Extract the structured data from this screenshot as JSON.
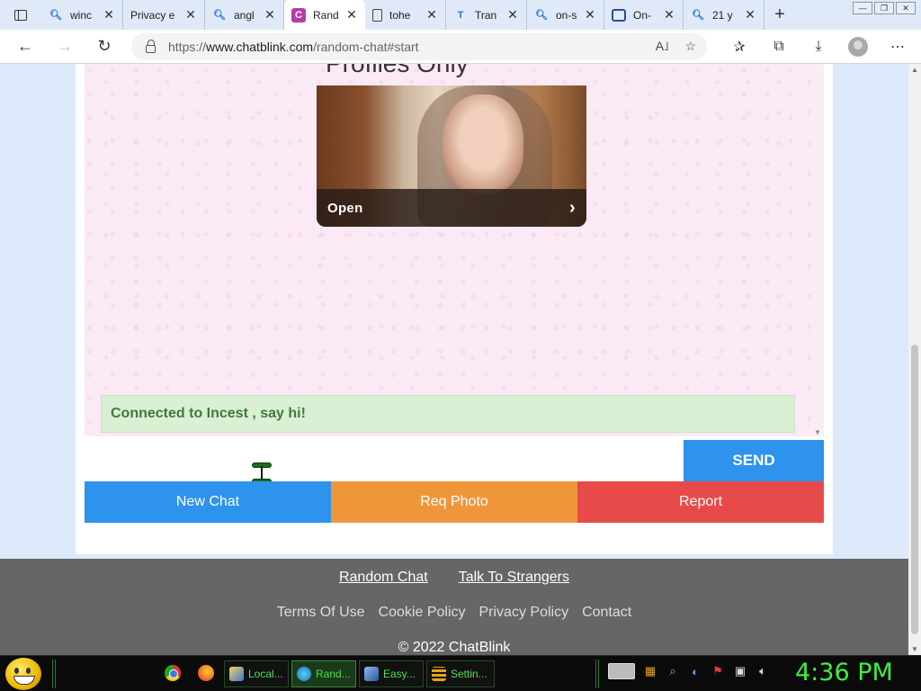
{
  "browser": {
    "tabs": [
      {
        "label": "winc",
        "icon": "search-icon",
        "active": false
      },
      {
        "label": "Privacy e",
        "icon": "none",
        "active": false
      },
      {
        "label": "angl",
        "icon": "search-icon",
        "active": false
      },
      {
        "label": "Rand",
        "icon": "chatblink-icon",
        "active": true
      },
      {
        "label": "tohe",
        "icon": "document-icon",
        "active": false
      },
      {
        "label": "Tran",
        "icon": "translate-icon",
        "active": false
      },
      {
        "label": "on-s",
        "icon": "search-icon",
        "active": false
      },
      {
        "label": "On-",
        "icon": "onenote-icon",
        "active": false
      },
      {
        "label": "21 y",
        "icon": "search-icon",
        "active": false
      }
    ],
    "url_prefix": "https://",
    "url_host": "www.chatblink.com",
    "url_path": "/random-chat#start"
  },
  "chat": {
    "promo_title": "Profiles Only",
    "promo_action": "Open",
    "status_message": "Connected to Incest , say hi!",
    "input_value": "",
    "send_label": "SEND",
    "actions": {
      "new_chat": "New Chat",
      "req_photo": "Req Photo",
      "report": "Report"
    },
    "colors": {
      "blue": "#2d93ec",
      "orange": "#f0963a",
      "red": "#e84a4a",
      "status_green": "#3f7a3a"
    }
  },
  "footer": {
    "primary_links": [
      "Random Chat",
      "Talk To Strangers"
    ],
    "secondary_links": [
      "Terms Of Use",
      "Cookie Policy",
      "Privacy Policy",
      "Contact"
    ],
    "copyright": "© 2022 ChatBlink"
  },
  "taskbar": {
    "tasks": [
      {
        "label": "Local...",
        "icon": "folder-icon"
      },
      {
        "label": "Rand...",
        "icon": "edge-icon",
        "active": true
      },
      {
        "label": "Easy...",
        "icon": "app-icon"
      },
      {
        "label": "Settin...",
        "icon": "settings-icon"
      }
    ],
    "clock": "4:36 PM"
  }
}
